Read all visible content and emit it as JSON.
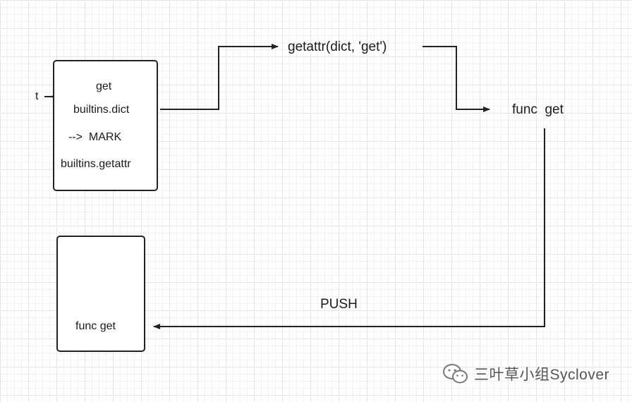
{
  "stack_box": {
    "t_label": "t",
    "items": [
      "get",
      "builtins.dict",
      "-->  MARK",
      "builtins.getattr"
    ]
  },
  "call_label": "getattr(dict, 'get')",
  "result_label": "func  get",
  "push_label": "PUSH",
  "result_box": {
    "label": "func get"
  },
  "watermark": {
    "text": "三叶草小组Syclover",
    "icon": "wechat-icon"
  }
}
